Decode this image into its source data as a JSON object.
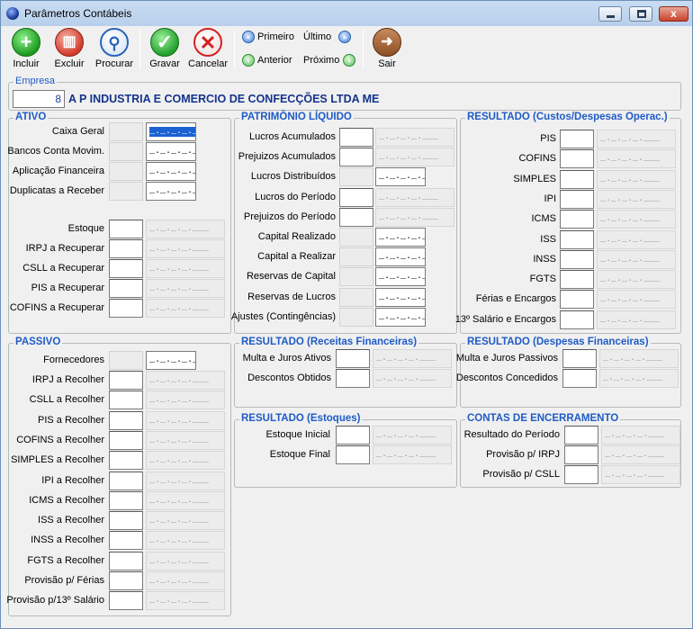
{
  "window": {
    "title": "Parâmetros Contábeis",
    "close_glyph": "x"
  },
  "toolbar": {
    "incluir": "Incluir",
    "excluir": "Excluir",
    "procurar": "Procurar",
    "gravar": "Gravar",
    "cancelar": "Cancelar",
    "primeiro": "Primeiro",
    "ultimo": "Último",
    "anterior": "Anterior",
    "proximo": "Próximo",
    "sair": "Sair"
  },
  "empresa": {
    "title": "Empresa",
    "code": "8",
    "name": "A P  INDUSTRIA E COMERCIO DE CONFECÇÕES LTDA ME"
  },
  "mask": "_._._._.___",
  "ativo": {
    "title": "ATIVO",
    "top": [
      "Caixa Geral",
      "Bancos Conta Movim.",
      "Aplicação Financeira",
      "Duplicatas a Receber"
    ],
    "bottom": [
      "Estoque",
      "IRPJ a Recuperar",
      "CSLL a Recuperar",
      "PIS a Recuperar",
      "COFINS a Recuperar"
    ]
  },
  "passivo": {
    "title": "PASSIVO",
    "top": [
      "Fornecedores"
    ],
    "bottom": [
      "IRPJ a Recolher",
      "CSLL a Recolher",
      "PIS a Recolher",
      "COFINS a Recolher",
      "SIMPLES a Recolher",
      "IPI a Recolher",
      "ICMS a Recolher",
      "ISS a Recolher",
      "INSS a Recolher",
      "FGTS a Recolher",
      "Provisão p/ Férias",
      "Provisão p/13º Salário"
    ]
  },
  "pl": {
    "title": "PATRIMÔNIO LÍQUIDO",
    "rows": [
      "Lucros Acumulados",
      "Prejuizos Acumulados",
      "Lucros Distribuídos",
      "Lucros do Período",
      "Prejuizos do Período",
      "Capital Realizado",
      "Capital a Realizar",
      "Reservas de Capital",
      "Reservas de Lucros",
      "Ajustes (Contingências)"
    ]
  },
  "resultado_custos": {
    "title": "RESULTADO (Custos/Despesas Operac.)",
    "rows": [
      "PIS",
      "COFINS",
      "SIMPLES",
      "IPI",
      "ICMS",
      "ISS",
      "INSS",
      "FGTS",
      "Férias e Encargos",
      "13º Salário e Encargos"
    ]
  },
  "receitas_fin": {
    "title": "RESULTADO (Receitas Financeiras)",
    "rows": [
      "Multa e Juros Ativos",
      "Descontos Obtidos"
    ]
  },
  "despesas_fin": {
    "title": "RESULTADO (Despesas Financeiras)",
    "rows": [
      "Multa e Juros Passivos",
      "Descontos Concedidos"
    ]
  },
  "estoques": {
    "title": "RESULTADO (Estoques)",
    "rows": [
      "Estoque Inicial",
      "Estoque Final"
    ]
  },
  "encerramento": {
    "title": "CONTAS DE ENCERRAMENTO",
    "rows": [
      "Resultado do Período",
      "Provisão p/ IRPJ",
      "Provisão p/ CSLL"
    ]
  }
}
